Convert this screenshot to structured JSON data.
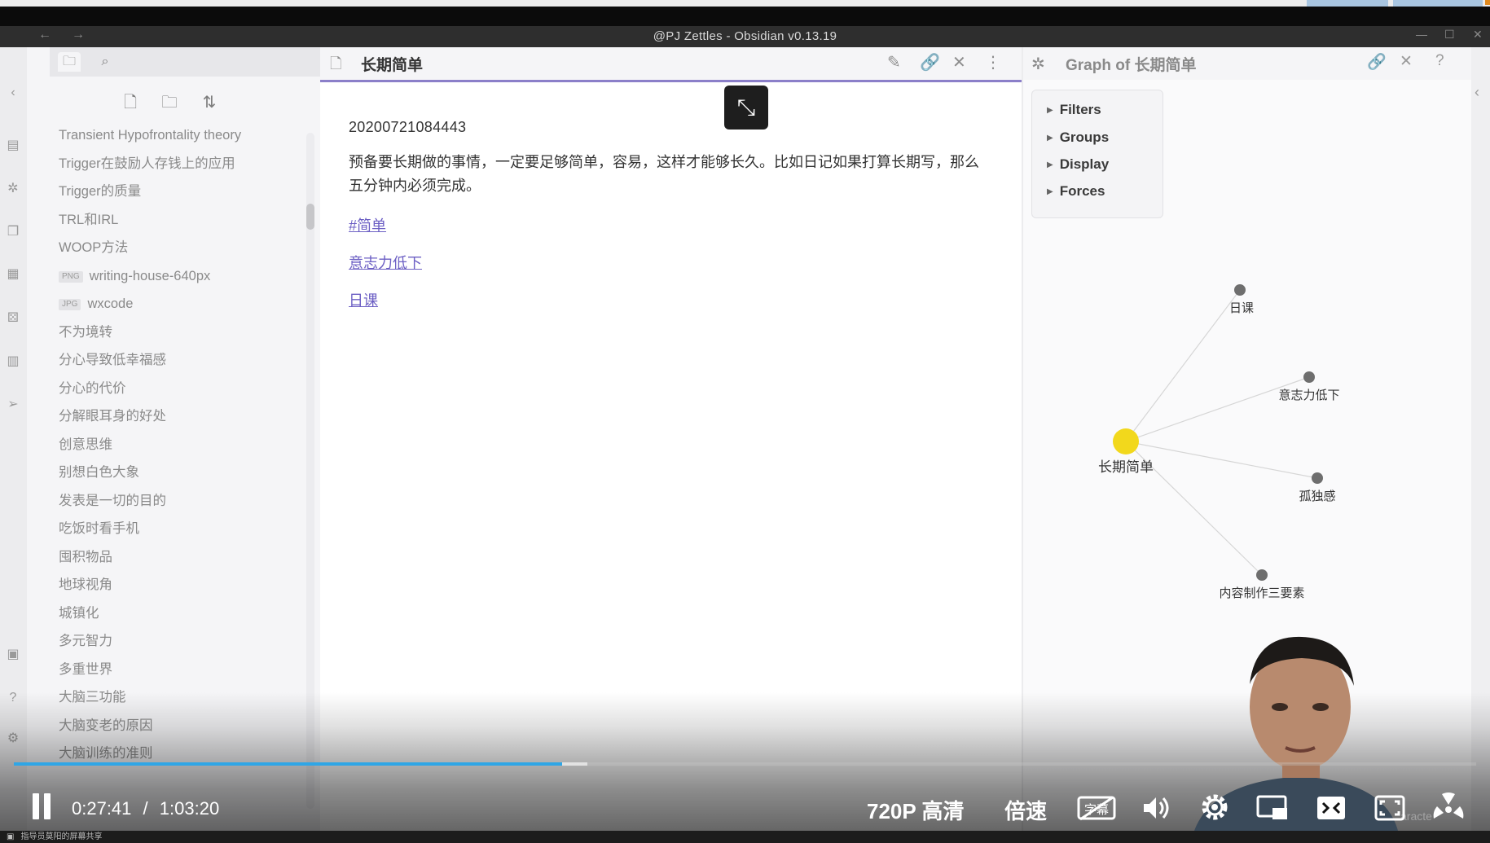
{
  "window": {
    "title": "@PJ Zettles - Obsidian v0.13.19",
    "nav_back": "←",
    "nav_forward": "→",
    "minimize": "—",
    "maximize": "☐",
    "close": "✕"
  },
  "sidebar": {
    "files": [
      {
        "name": "Transient Hypofrontality theory"
      },
      {
        "name": "Trigger在鼓励人存钱上的应用"
      },
      {
        "name": "Trigger的质量"
      },
      {
        "name": "TRL和IRL"
      },
      {
        "name": "WOOP方法"
      },
      {
        "name": "writing-house-640px",
        "ext": "PNG"
      },
      {
        "name": "wxcode",
        "ext": "JPG"
      },
      {
        "name": "不为境转"
      },
      {
        "name": "分心导致低幸福感"
      },
      {
        "name": "分心的代价"
      },
      {
        "name": "分解眼耳身的好处"
      },
      {
        "name": "创意思维"
      },
      {
        "name": "别想白色大象"
      },
      {
        "name": "发表是一切的目的"
      },
      {
        "name": "吃饭时看手机"
      },
      {
        "name": "囤积物品"
      },
      {
        "name": "地球视角"
      },
      {
        "name": "城镇化"
      },
      {
        "name": "多元智力"
      },
      {
        "name": "多重世界"
      },
      {
        "name": "大脑三功能"
      },
      {
        "name": "大脑变老的原因"
      },
      {
        "name": "大脑训练的准则"
      }
    ]
  },
  "editor": {
    "title": "长期简单",
    "date_id": "20200721084443",
    "paragraph": "预备要长期做的事情，一定要足够简单，容易，这样才能够长久。比如日记如果打算长期写，那么五分钟内必须完成。",
    "links": [
      "#简单",
      "意志力低下",
      "日课"
    ]
  },
  "graph": {
    "title": "Graph of 长期简单",
    "controls": [
      "Filters",
      "Groups",
      "Display",
      "Forces"
    ],
    "center_node": "长期简单",
    "nodes": [
      "日课",
      "意志力低下",
      "孤独感",
      "内容制作三要素"
    ],
    "center_color": "#f2d81c",
    "node_color": "#6e6e6e"
  },
  "video": {
    "current_time": "0:27:41",
    "separator": "/",
    "duration": "1:03:20",
    "progress": 0.375,
    "buffered": 0.392,
    "quality": "720P 高清",
    "speed": "倍速",
    "subtitle_label": "字幕",
    "accent": "#2fa6e6"
  },
  "status": {
    "text": "指导员莫阳的屏幕共享"
  }
}
